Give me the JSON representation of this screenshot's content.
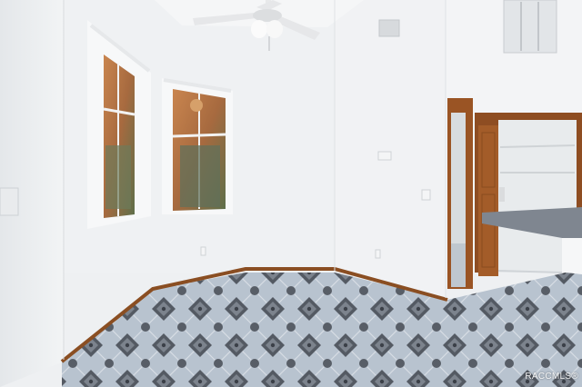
{
  "photo": {
    "watermark": "RACCMLS®",
    "colors": {
      "wall": "#eef0f2",
      "wall_shadow": "#e2e5e8",
      "ceiling": "#f3f4f5",
      "baseboard": "#8a4e22",
      "door_wood": "#9a5424",
      "floor_light": "#b9c4d0",
      "floor_dark": "#565c66",
      "counter": "#7f8690",
      "window_glass": "#b9774a"
    }
  }
}
